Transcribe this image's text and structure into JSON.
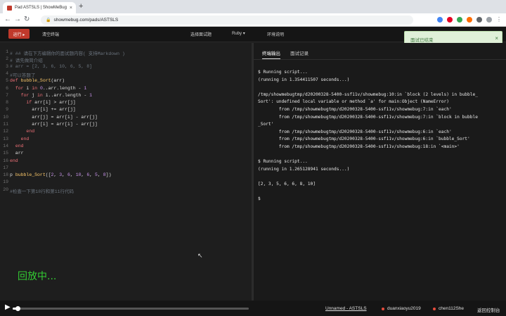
{
  "browser": {
    "tab_title": "Pad ASTSLS | ShowMeBug",
    "url": "showmebug.com/pads/ASTSLS",
    "tab_close": "×",
    "new_tab": "+"
  },
  "header": {
    "run_label": "运行 ▸",
    "clear_label": "清空终端",
    "question_label": "选择面试题",
    "language_label": "Ruby",
    "env_label": "环境说明"
  },
  "toast": {
    "text": "面试已结束",
    "close": "×"
  },
  "editor": {
    "line_numbers": [
      "1",
      "2",
      "3",
      "4",
      "5",
      "6",
      "7",
      "8",
      "9",
      "10",
      "11",
      "12",
      "13",
      "14",
      "15",
      "16",
      "17",
      "18",
      "19",
      "20"
    ],
    "lines": [
      "# ## 请在下方编辑你的面试题内容( 支持Markdown )",
      "# 请先做简介绍",
      "# arr = [2, 3, 6, 10, 6, 5, 8]",
      "#可以答题了",
      "def bubble_Sort(arr)",
      "  for i in 0..arr.length - 1",
      "    for j in i..arr.length - 1",
      "      if arr[i] > arr[j]",
      "        arr[i] += arr[j]",
      "        arr[j] = arr[i] - arr[j]",
      "        arr[i] = arr[i] - arr[j]",
      "      end",
      "    end",
      "  end",
      "  arr",
      "end",
      "",
      "p bubble_Sort([2, 3, 6, 10, 6, 5, 8])",
      "",
      "#检查一下第18行和第11行代码"
    ],
    "replay_text": "回放中...",
    "cursor_glyph": "↖"
  },
  "terminal": {
    "tab_output": "终端输出",
    "tab_history": "面试记录",
    "lines": [
      "$ Running script...",
      "(running in 1.354411507 seconds...)",
      "",
      "/tmp/showmebugtmp/d20200328-5400-ssf11v/showmebug:10:in `block (2 levels) in bubble_",
      "Sort': undefined local variable or method `a' for main:Object (NameError)",
      "        from /tmp/showmebugtmp/d20200328-5400-ssf11v/showmebug:7:in `each'",
      "        from /tmp/showmebugtmp/d20200328-5400-ssf11v/showmebug:7:in `block in bubble",
      "_Sort'",
      "        from /tmp/showmebugtmp/d20200328-5400-ssf11v/showmebug:6:in `each'",
      "        from /tmp/showmebugtmp/d20200328-5400-ssf11v/showmebug:6:in `bubble_Sort'",
      "        from /tmp/showmebugtmp/d20200328-5400-ssf11v/showmebug:18:in `<main>'",
      "",
      "$ Running script...",
      "(running in 1.265128941 seconds...)",
      "",
      "[2, 3, 5, 6, 6, 8, 10]",
      "",
      "$"
    ]
  },
  "playback": {
    "progress": 0.02,
    "play_glyph": "▶",
    "pad_name": "Unnamed - ASTSLS",
    "users": [
      "duanxiaoyu2019",
      "chen112She"
    ],
    "back_label": "返回控制台"
  },
  "colors": {
    "run_button": "#c0392b",
    "replay_text": "#33cc33",
    "toast_bg": "#dff0d8"
  }
}
